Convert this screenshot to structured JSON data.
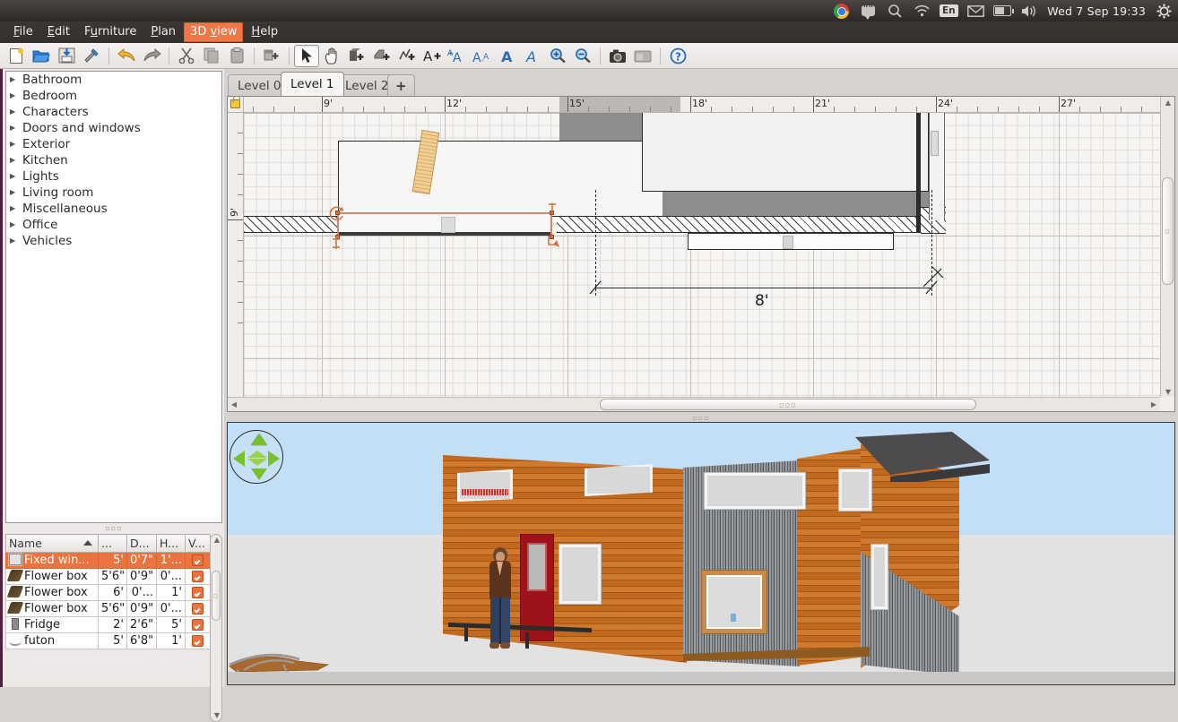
{
  "system_panel": {
    "icons": [
      "chrome-icon",
      "messages-icon",
      "search-icon",
      "wifi-icon",
      "keyboard-layout-icon",
      "mail-icon",
      "battery-icon",
      "volume-icon",
      "power-gear-icon"
    ],
    "keyboard_layout": "En",
    "clock": "Wed 7 Sep 19:33"
  },
  "menubar": {
    "items": [
      {
        "label": "File",
        "mnemonic": "F",
        "active": false
      },
      {
        "label": "Edit",
        "mnemonic": "E",
        "active": false
      },
      {
        "label": "Furniture",
        "mnemonic": "u",
        "active": false
      },
      {
        "label": "Plan",
        "mnemonic": "P",
        "active": false
      },
      {
        "label": "3D view",
        "mnemonic": "v",
        "active": true
      },
      {
        "label": "Help",
        "mnemonic": "H",
        "active": false
      }
    ]
  },
  "toolbar": {
    "buttons": [
      {
        "name": "new-home-icon",
        "tip": "New home"
      },
      {
        "name": "open-icon",
        "tip": "Open"
      },
      {
        "name": "save-icon",
        "tip": "Save"
      },
      {
        "name": "preferences-icon",
        "tip": "Preferences"
      },
      {
        "name": "undo-icon",
        "tip": "Undo"
      },
      {
        "name": "redo-icon",
        "tip": "Redo"
      },
      {
        "name": "cut-icon",
        "tip": "Cut"
      },
      {
        "name": "copy-icon",
        "tip": "Copy"
      },
      {
        "name": "paste-icon",
        "tip": "Paste"
      },
      {
        "name": "add-furniture-icon",
        "tip": "Add furniture"
      },
      {
        "name": "select-pointer-icon",
        "tip": "Select",
        "pressed": true
      },
      {
        "name": "pan-hand-icon",
        "tip": "Pan"
      },
      {
        "name": "create-walls-icon",
        "tip": "Create walls"
      },
      {
        "name": "create-room-icon",
        "tip": "Create rooms"
      },
      {
        "name": "create-polyline-icon",
        "tip": "Create polylines"
      },
      {
        "name": "add-text-icon",
        "tip": "Add texts"
      },
      {
        "name": "increase-text-size-icon",
        "tip": "Increase text size"
      },
      {
        "name": "decrease-text-size-icon",
        "tip": "Decrease text size"
      },
      {
        "name": "bold-text-icon",
        "tip": "Toggle bold style"
      },
      {
        "name": "italic-text-icon",
        "tip": "Toggle italic style"
      },
      {
        "name": "zoom-in-icon",
        "tip": "Zoom in"
      },
      {
        "name": "zoom-out-icon",
        "tip": "Zoom out"
      },
      {
        "name": "photo-create-icon",
        "tip": "Create photo"
      },
      {
        "name": "video-create-icon",
        "tip": "Create video"
      },
      {
        "name": "help-icon",
        "tip": "Help"
      }
    ]
  },
  "catalog": {
    "items": [
      {
        "label": "Bathroom"
      },
      {
        "label": "Bedroom"
      },
      {
        "label": "Characters"
      },
      {
        "label": "Doors and windows"
      },
      {
        "label": "Exterior"
      },
      {
        "label": "Kitchen"
      },
      {
        "label": "Lights"
      },
      {
        "label": "Living room"
      },
      {
        "label": "Miscellaneous"
      },
      {
        "label": "Office"
      },
      {
        "label": "Vehicles"
      }
    ]
  },
  "furniture_list": {
    "columns": [
      "Name",
      "...",
      "D...",
      "H...",
      "V..."
    ],
    "sorted_by": "Name",
    "sort_direction": "ascending",
    "rows": [
      {
        "icon": "window-icon",
        "name": "Fixed win...",
        "width": "5'",
        "depth": "0'7\"",
        "height": "1'...",
        "visible": true,
        "selected": true
      },
      {
        "icon": "flower-box-icon",
        "name": "Flower box",
        "width": "5'6\"",
        "depth": "0'9\"",
        "height": "0'...",
        "visible": true,
        "selected": false
      },
      {
        "icon": "flower-box-icon",
        "name": "Flower box",
        "width": "6'",
        "depth": "0'...",
        "height": "1'",
        "visible": true,
        "selected": false
      },
      {
        "icon": "flower-box-icon",
        "name": "Flower box",
        "width": "5'6\"",
        "depth": "0'9\"",
        "height": "0'...",
        "visible": true,
        "selected": false
      },
      {
        "icon": "fridge-icon",
        "name": "Fridge",
        "width": "2'",
        "depth": "2'6\"",
        "height": "5'",
        "visible": true,
        "selected": false
      },
      {
        "icon": "futon-icon",
        "name": "futon",
        "width": "5'",
        "depth": "6'8\"",
        "height": "1'",
        "visible": true,
        "selected": false
      }
    ]
  },
  "plan": {
    "tabs": [
      {
        "label": "Level 0",
        "selected": false
      },
      {
        "label": "Level 1",
        "selected": true
      },
      {
        "label": "Level 2",
        "selected": false
      }
    ],
    "add_level_label": "+",
    "ruler_unit": "feet",
    "ruler_top_labels": [
      "9'",
      "12'",
      "15'",
      "18'",
      "21'",
      "24'",
      "27'"
    ],
    "ruler_left_labels": [
      "9'"
    ],
    "dimension_label": "8'",
    "lock_base_plan_icon": "lock-icon"
  },
  "view3d": {
    "navigation_icon": "navigation-compass-icon",
    "sky_color": "#c3def7",
    "ground_color": "#e4e2e1",
    "objects": [
      "tiny-house",
      "woman-character",
      "bench"
    ]
  },
  "colors": {
    "accent": "#ea7340",
    "menu_active": "#f07746",
    "panel_border": "#50203f",
    "selection_outline": "#c98a6e"
  }
}
